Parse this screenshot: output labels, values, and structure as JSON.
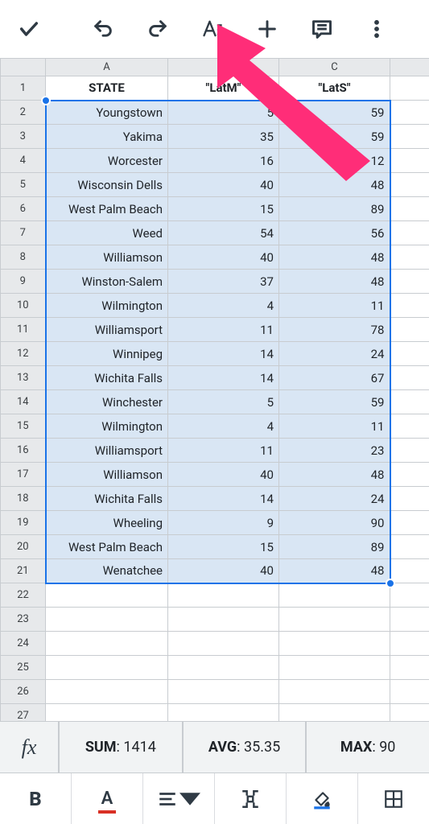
{
  "headers": {
    "A": "STATE",
    "B": "\"LatM\"",
    "C": "\"LatS\""
  },
  "cols": [
    "A",
    "B",
    "C"
  ],
  "rows": [
    {
      "n": 2,
      "state": "Youngstown",
      "latm": 5,
      "lats": 59
    },
    {
      "n": 3,
      "state": "Yakima",
      "latm": 35,
      "lats": 59
    },
    {
      "n": 4,
      "state": "Worcester",
      "latm": 16,
      "lats": 12
    },
    {
      "n": 5,
      "state": "Wisconsin Dells",
      "latm": 40,
      "lats": 48
    },
    {
      "n": 6,
      "state": "West Palm Beach",
      "latm": 15,
      "lats": 89
    },
    {
      "n": 7,
      "state": "Weed",
      "latm": 54,
      "lats": 56
    },
    {
      "n": 8,
      "state": "Williamson",
      "latm": 40,
      "lats": 48
    },
    {
      "n": 9,
      "state": "Winston-Salem",
      "latm": 37,
      "lats": 48
    },
    {
      "n": 10,
      "state": "Wilmington",
      "latm": 4,
      "lats": 11
    },
    {
      "n": 11,
      "state": "Williamsport",
      "latm": 11,
      "lats": 78
    },
    {
      "n": 12,
      "state": "Winnipeg",
      "latm": 14,
      "lats": 24
    },
    {
      "n": 13,
      "state": "Wichita Falls",
      "latm": 14,
      "lats": 67
    },
    {
      "n": 14,
      "state": "Winchester",
      "latm": 5,
      "lats": 59
    },
    {
      "n": 15,
      "state": "Wilmington",
      "latm": 4,
      "lats": 11
    },
    {
      "n": 16,
      "state": "Williamsport",
      "latm": 11,
      "lats": 23
    },
    {
      "n": 17,
      "state": "Williamson",
      "latm": 40,
      "lats": 48
    },
    {
      "n": 18,
      "state": "Wichita Falls",
      "latm": 14,
      "lats": 24
    },
    {
      "n": 19,
      "state": "Wheeling",
      "latm": 9,
      "lats": 90
    },
    {
      "n": 20,
      "state": "West Palm Beach",
      "latm": 15,
      "lats": 89
    },
    {
      "n": 21,
      "state": "Wenatchee",
      "latm": 40,
      "lats": 48
    }
  ],
  "empty_rows": [
    22,
    23,
    24,
    25,
    26,
    27
  ],
  "stats": {
    "sum_label": "SUM",
    "sum_value": "1414",
    "avg_label": "AVG",
    "avg_value": "35.35",
    "max_label": "MAX",
    "max_value": "90"
  },
  "fx": "fx"
}
